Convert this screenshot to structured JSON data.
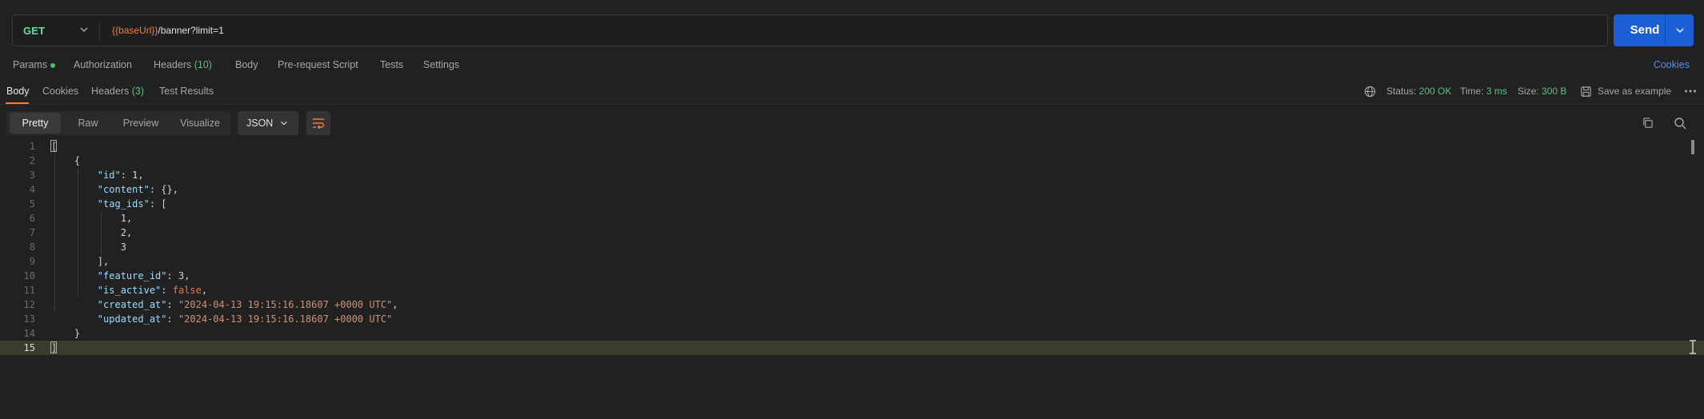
{
  "request": {
    "method": "GET",
    "url_var": "{{baseUrl}}",
    "url_path": "/banner?limit=1",
    "send_label": "Send"
  },
  "request_tabs": {
    "params": "Params",
    "authorization": "Authorization",
    "headers": "Headers",
    "headers_count": "(10)",
    "body": "Body",
    "pre_request": "Pre-request Script",
    "tests": "Tests",
    "settings": "Settings",
    "cookies_link": "Cookies"
  },
  "response_tabs": {
    "body": "Body",
    "cookies": "Cookies",
    "headers": "Headers",
    "headers_count": "(3)",
    "test_results": "Test Results"
  },
  "response_meta": {
    "status_label": "Status:",
    "status_value": "200 OK",
    "time_label": "Time:",
    "time_value": "3 ms",
    "size_label": "Size:",
    "size_value": "300 B",
    "save_example": "Save as example"
  },
  "format_bar": {
    "pretty": "Pretty",
    "raw": "Raw",
    "preview": "Preview",
    "visualize": "Visualize",
    "language": "JSON"
  },
  "code_lines": [
    {
      "num": "1"
    },
    {
      "num": "2"
    },
    {
      "num": "3",
      "key": "\"id\"",
      "val_num": "1"
    },
    {
      "num": "4",
      "key": "\"content\"",
      "val_plain": "{}"
    },
    {
      "num": "5",
      "key": "\"tag_ids\"",
      "val_plain": "["
    },
    {
      "num": "6",
      "val_num": "1"
    },
    {
      "num": "7",
      "val_num": "2"
    },
    {
      "num": "8",
      "val_num": "3"
    },
    {
      "num": "9"
    },
    {
      "num": "10",
      "key": "\"feature_id\"",
      "val_num": "3"
    },
    {
      "num": "11",
      "key": "\"is_active\"",
      "val_bool": "false"
    },
    {
      "num": "12",
      "key": "\"created_at\"",
      "val_str": "\"2024-04-13 19:15:16.18607 +0000 UTC\""
    },
    {
      "num": "13",
      "key": "\"updated_at\"",
      "val_str": "\"2024-04-13 19:15:16.18607 +0000 UTC\""
    },
    {
      "num": "14"
    },
    {
      "num": "15"
    }
  ]
}
